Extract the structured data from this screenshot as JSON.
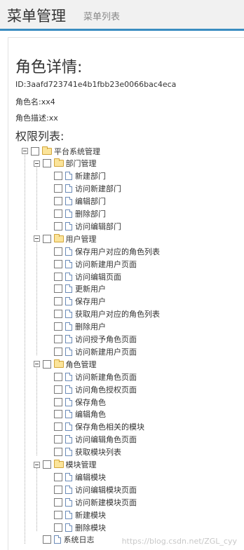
{
  "header": {
    "title": "菜单管理",
    "subtitle": "菜单列表"
  },
  "detail": {
    "heading": "角色详情:",
    "id_line": "ID:3aafd723741e4b1fbb23e0066bac4eca",
    "name_line": "角色名:xx4",
    "desc_line": "角色描述:xx"
  },
  "permissions": {
    "heading": "权限列表:",
    "tree": [
      {
        "label": "平台系统管理",
        "level": 0,
        "type": "folder",
        "expandable": true
      },
      {
        "label": "部门管理",
        "level": 1,
        "type": "folder",
        "expandable": true
      },
      {
        "label": "新建部门",
        "level": 2,
        "type": "file",
        "expandable": false
      },
      {
        "label": "访问新建部门",
        "level": 2,
        "type": "file",
        "expandable": false
      },
      {
        "label": "编辑部门",
        "level": 2,
        "type": "file",
        "expandable": false
      },
      {
        "label": "删除部门",
        "level": 2,
        "type": "file",
        "expandable": false
      },
      {
        "label": "访问编辑部门",
        "level": 2,
        "type": "file",
        "expandable": false
      },
      {
        "label": "用户管理",
        "level": 1,
        "type": "folder",
        "expandable": true
      },
      {
        "label": " 保存用户对应的角色列表",
        "level": 2,
        "type": "file",
        "expandable": false
      },
      {
        "label": "访问新建用户页面",
        "level": 2,
        "type": "file",
        "expandable": false
      },
      {
        "label": " 访问编辑页面",
        "level": 2,
        "type": "file",
        "expandable": false
      },
      {
        "label": "更新用户",
        "level": 2,
        "type": "file",
        "expandable": false
      },
      {
        "label": "保存用户",
        "level": 2,
        "type": "file",
        "expandable": false
      },
      {
        "label": "获取用户对应的角色列表",
        "level": 2,
        "type": "file",
        "expandable": false
      },
      {
        "label": " 删除用户",
        "level": 2,
        "type": "file",
        "expandable": false
      },
      {
        "label": " 访问授予角色页面",
        "level": 2,
        "type": "file",
        "expandable": false
      },
      {
        "label": " 访问新建用户页面",
        "level": 2,
        "type": "file",
        "expandable": false
      },
      {
        "label": "角色管理",
        "level": 1,
        "type": "folder",
        "expandable": true
      },
      {
        "label": " 访问新建角色页面",
        "level": 2,
        "type": "file",
        "expandable": false
      },
      {
        "label": "访问角色授权页面",
        "level": 2,
        "type": "file",
        "expandable": false
      },
      {
        "label": "保存角色",
        "level": 2,
        "type": "file",
        "expandable": false
      },
      {
        "label": "编辑角色",
        "level": 2,
        "type": "file",
        "expandable": false
      },
      {
        "label": "保存角色相关的模块",
        "level": 2,
        "type": "file",
        "expandable": false
      },
      {
        "label": "访问编辑角色页面",
        "level": 2,
        "type": "file",
        "expandable": false
      },
      {
        "label": "获取模块列表",
        "level": 2,
        "type": "file",
        "expandable": false
      },
      {
        "label": "模块管理",
        "level": 1,
        "type": "folder",
        "expandable": true
      },
      {
        "label": "编辑模块",
        "level": 2,
        "type": "file",
        "expandable": false
      },
      {
        "label": "访问编辑模块页面",
        "level": 2,
        "type": "file",
        "expandable": false
      },
      {
        "label": "访问新建模块页面",
        "level": 2,
        "type": "file",
        "expandable": false
      },
      {
        "label": "新建模块",
        "level": 2,
        "type": "file",
        "expandable": false
      },
      {
        "label": "删除模块",
        "level": 2,
        "type": "file",
        "expandable": false
      },
      {
        "label": "系统日志",
        "level": 1,
        "type": "file",
        "expandable": false
      }
    ]
  },
  "watermark": "https://blog.csdn.net/ZGL_cyy",
  "colors": {
    "header_border": "#3a8dc1",
    "folder": "#fbe49a",
    "file_border": "#6b8bb8"
  }
}
